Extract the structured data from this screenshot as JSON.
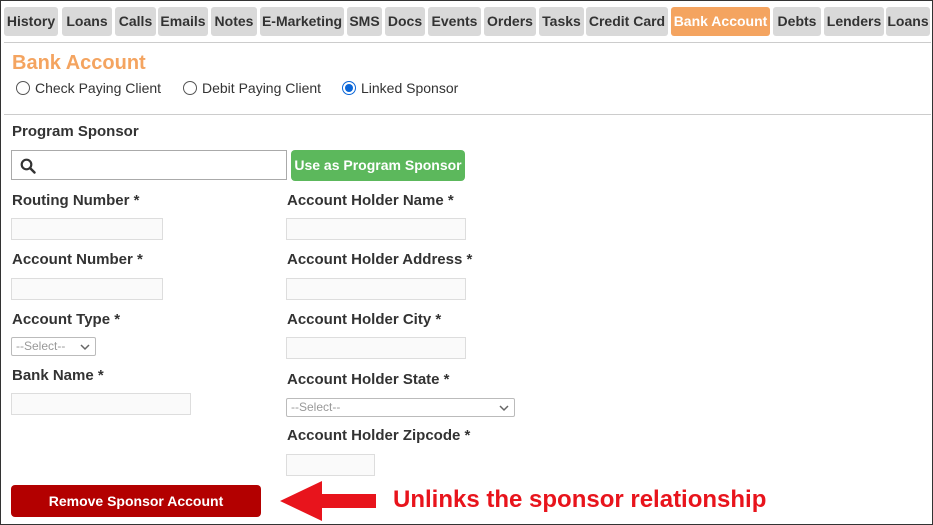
{
  "tabs": [
    {
      "label": "History"
    },
    {
      "label": "Loans"
    },
    {
      "label": "Calls"
    },
    {
      "label": "Emails"
    },
    {
      "label": "Notes"
    },
    {
      "label": "E-Marketing"
    },
    {
      "label": "SMS"
    },
    {
      "label": "Docs"
    },
    {
      "label": "Events"
    },
    {
      "label": "Orders"
    },
    {
      "label": "Tasks"
    },
    {
      "label": "Credit Card"
    },
    {
      "label": "Bank Account"
    },
    {
      "label": "Debts"
    },
    {
      "label": "Lenders"
    },
    {
      "label": "Loans"
    }
  ],
  "active_tab": "Bank Account",
  "section_title": "Bank Account",
  "payment_options": [
    {
      "label": "Check Paying Client",
      "checked": false
    },
    {
      "label": "Debit Paying Client",
      "checked": false
    },
    {
      "label": "Linked Sponsor",
      "checked": true
    }
  ],
  "program_sponsor": {
    "label": "Program Sponsor",
    "search_value": "",
    "use_button": "Use as Program Sponsor"
  },
  "fields": {
    "routing_number": "Routing Number *",
    "account_number": "Account Number *",
    "account_type": "Account Type *",
    "account_type_select": "--Select--",
    "bank_name": "Bank Name *",
    "holder_name": "Account Holder Name *",
    "holder_address": "Account Holder Address *",
    "holder_city": "Account Holder City *",
    "holder_state": "Account Holder State *",
    "holder_state_select": "--Select--",
    "holder_zipcode": "Account Holder Zipcode *"
  },
  "remove_button": "Remove Sponsor Account",
  "annotation": "Unlinks the sponsor relationship",
  "colors": {
    "accent": "#f4a460",
    "green_button": "#5cb85c",
    "red_button": "#b30000",
    "annotation": "#e8141c",
    "radio_checked": "#0a66d8"
  }
}
